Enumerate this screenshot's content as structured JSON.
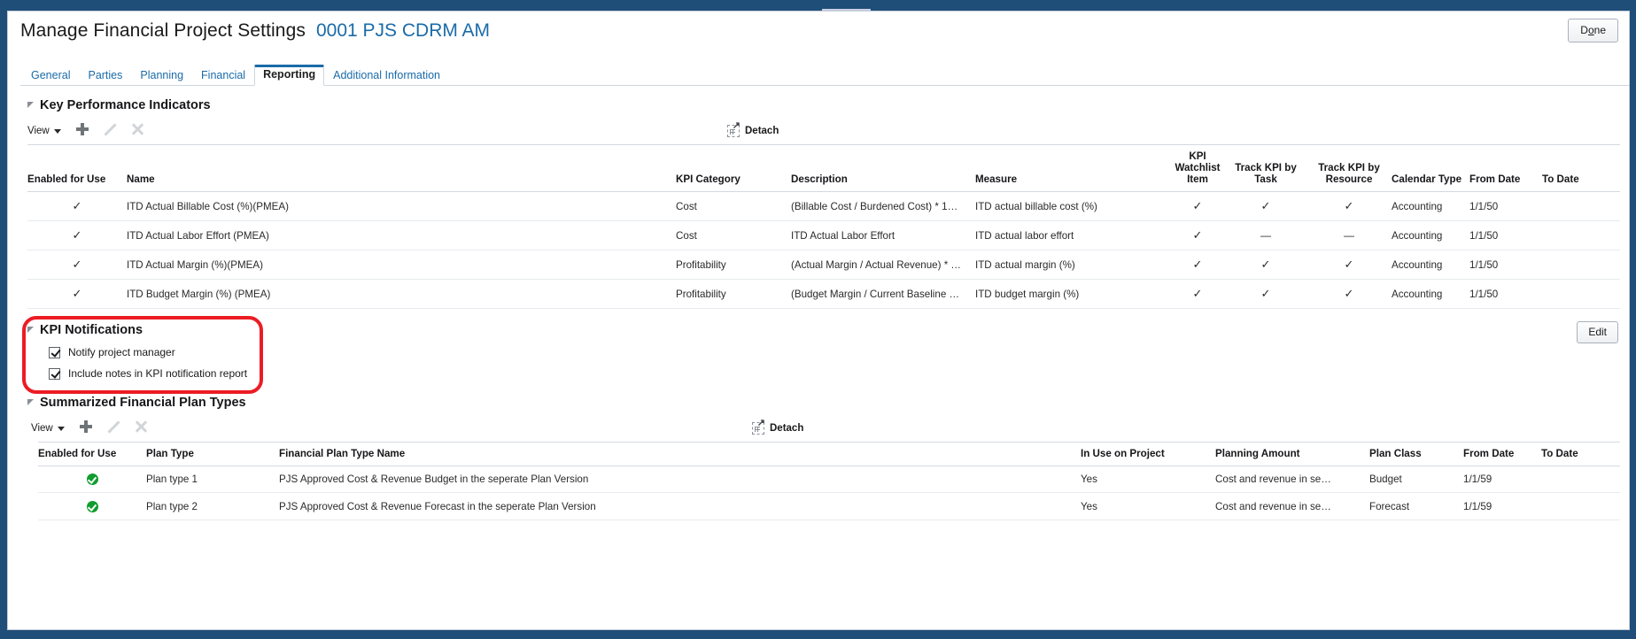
{
  "header": {
    "title": "Manage Financial Project Settings",
    "subtitle": "0001 PJS CDRM AM",
    "done_label": "Done"
  },
  "tabs": [
    {
      "label": "General",
      "active": false
    },
    {
      "label": "Parties",
      "active": false
    },
    {
      "label": "Planning",
      "active": false
    },
    {
      "label": "Financial",
      "active": false
    },
    {
      "label": "Reporting",
      "active": true
    },
    {
      "label": "Additional Information",
      "active": false
    }
  ],
  "kpi_section": {
    "title": "Key Performance Indicators",
    "toolbar": {
      "view_label": "View",
      "add_icon": "plus-icon",
      "edit_icon": "pencil-icon",
      "delete_icon": "x-icon",
      "detach_label": "Detach",
      "detach_icon": "detach-icon"
    },
    "columns": [
      "Enabled for Use",
      "Name",
      "KPI Category",
      "Description",
      "Measure",
      "KPI Watchlist Item",
      "Track KPI by Task",
      "Track KPI by Resource",
      "Calendar Type",
      "From Date",
      "To Date"
    ],
    "rows": [
      {
        "enabled": "✓",
        "name": "ITD Actual Billable Cost (%)(PMEA)",
        "category": "Cost",
        "description": "(Billable Cost / Burdened Cost) * 1…",
        "measure": "ITD actual billable cost (%)",
        "watchlist": "✓",
        "track_task": "✓",
        "track_resource": "✓",
        "calendar_type": "Accounting",
        "from_date": "1/1/50",
        "to_date": ""
      },
      {
        "enabled": "✓",
        "name": "ITD Actual Labor Effort (PMEA)",
        "category": "Cost",
        "description": "ITD Actual Labor Effort",
        "measure": "ITD actual labor effort",
        "watchlist": "✓",
        "track_task": "—",
        "track_resource": "—",
        "calendar_type": "Accounting",
        "from_date": "1/1/50",
        "to_date": ""
      },
      {
        "enabled": "✓",
        "name": "ITD Actual Margin (%)(PMEA)",
        "category": "Profitability",
        "description": "(Actual Margin / Actual Revenue) * …",
        "measure": "ITD actual margin (%)",
        "watchlist": "✓",
        "track_task": "✓",
        "track_resource": "✓",
        "calendar_type": "Accounting",
        "from_date": "1/1/50",
        "to_date": ""
      },
      {
        "enabled": "✓",
        "name": "ITD Budget Margin (%) (PMEA)",
        "category": "Profitability",
        "description": "(Budget Margin / Current Baseline …",
        "measure": "ITD budget margin (%)",
        "watchlist": "✓",
        "track_task": "✓",
        "track_resource": "✓",
        "calendar_type": "Accounting",
        "from_date": "1/1/50",
        "to_date": ""
      }
    ]
  },
  "kpi_notifications": {
    "title": "KPI Notifications",
    "edit_label": "Edit",
    "checkboxes": [
      {
        "label": "Notify project manager",
        "checked": true
      },
      {
        "label": "Include notes in KPI notification report",
        "checked": true
      }
    ],
    "highlight_color": "#ec1c24"
  },
  "plan_types_section": {
    "title": "Summarized Financial Plan Types",
    "toolbar": {
      "view_label": "View",
      "add_icon": "plus-icon",
      "edit_icon": "pencil-icon",
      "delete_icon": "x-icon",
      "detach_label": "Detach",
      "detach_icon": "detach-icon"
    },
    "columns": [
      "Enabled for Use",
      "Plan Type",
      "Financial Plan Type Name",
      "In Use on Project",
      "Planning Amount",
      "Plan Class",
      "From Date",
      "To Date"
    ],
    "rows": [
      {
        "enabled_icon": "green-check-icon",
        "plan_type": "Plan type 1",
        "plan_type_name": "PJS Approved Cost & Revenue Budget in the seperate Plan Version",
        "in_use": "Yes",
        "planning_amount": "Cost and revenue in se…",
        "plan_class": "Budget",
        "from_date": "1/1/59",
        "to_date": ""
      },
      {
        "enabled_icon": "green-check-icon",
        "plan_type": "Plan type 2",
        "plan_type_name": "PJS Approved Cost & Revenue Forecast in the seperate Plan Version",
        "in_use": "Yes",
        "planning_amount": "Cost and revenue in se…",
        "plan_class": "Forecast",
        "from_date": "1/1/59",
        "to_date": ""
      }
    ]
  },
  "colors": {
    "chrome": "#1f4e79",
    "link": "#1a6ba8",
    "check": "#2c4d87",
    "green": "#0f9d2f"
  }
}
